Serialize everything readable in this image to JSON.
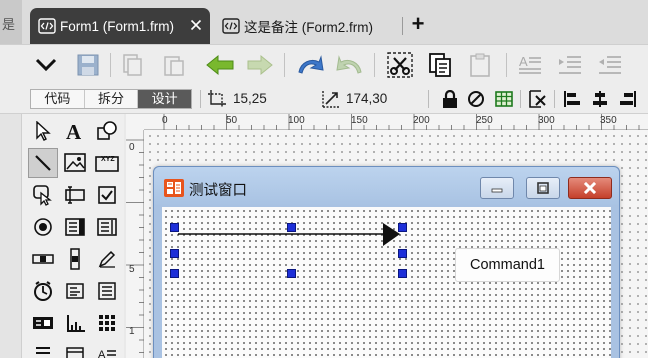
{
  "tabs": [
    {
      "label": "Form1 (Form1.frm)",
      "active": true
    },
    {
      "label": "这是备注 (Form2.frm)",
      "active": false
    }
  ],
  "left_strip_glyph": "是",
  "toolbar": {
    "buttons": [
      "dropdown-icon",
      "save-icon",
      "copy-disabled-icon",
      "paste-disabled-icon",
      "back-arrow-icon",
      "forward-arrow-icon",
      "undo-icon",
      "redo-icon",
      "cut-icon",
      "copy-icon",
      "paste-icon",
      "text-align-icon",
      "indent-icon",
      "outdent-icon"
    ]
  },
  "view_modes": [
    {
      "label": "代码",
      "active": false
    },
    {
      "label": "拆分",
      "active": false
    },
    {
      "label": "设计",
      "active": true
    }
  ],
  "position": {
    "value": "15,25"
  },
  "size": {
    "value": "174,30"
  },
  "ruler": {
    "h_labels": [
      "0",
      "50",
      "100",
      "150",
      "200",
      "250",
      "300",
      "350"
    ],
    "v_labels": [
      "0",
      "5",
      "1"
    ]
  },
  "form": {
    "title": "测试窗口",
    "button_caption": "Command1"
  },
  "colors": {
    "handle": "#1d2fd8",
    "titlebar": "#a9c3e3",
    "close_button": "#c5402b",
    "active_tab": "#3d3d3d"
  }
}
